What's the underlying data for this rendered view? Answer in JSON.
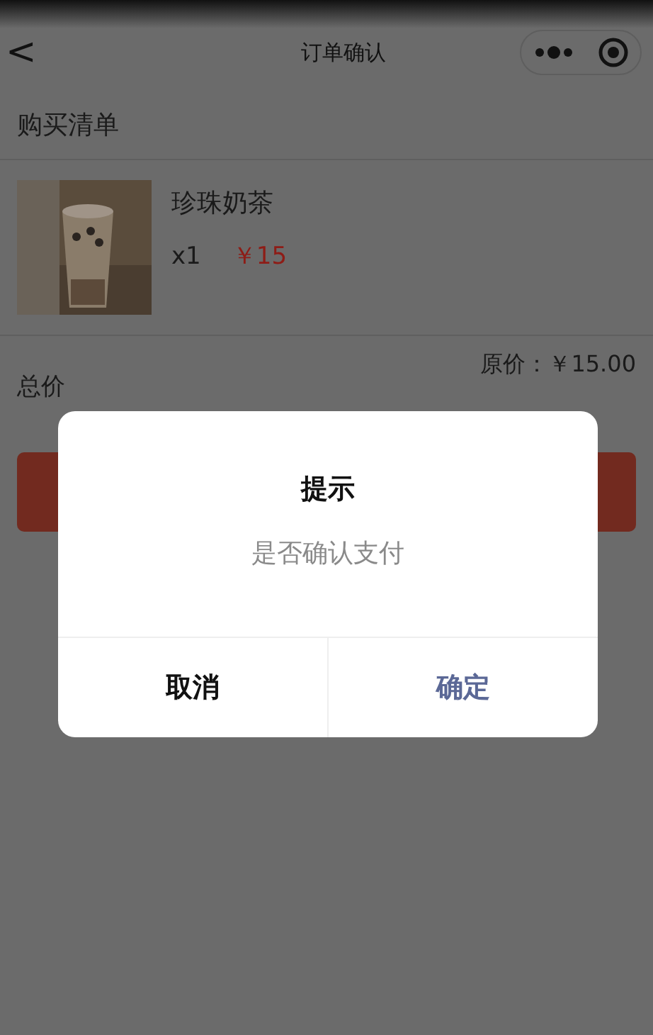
{
  "nav_bar": {
    "title": "订单确认",
    "back_icon": "<"
  },
  "section": {
    "title": "购买清单"
  },
  "items": [
    {
      "kind": "picture",
      "name": "珍珠奶茶",
      "quantity": "x1",
      "price": "￥15"
    }
  ],
  "total": {
    "label": "总价",
    "original_price": "原价：￥15.00"
  },
  "dialog": {
    "title": "提示",
    "message": "是否确认支付",
    "buttons": [
      {
        "label": "取消",
        "primary": false
      },
      {
        "label": "确定",
        "primary": true
      }
    ]
  }
}
